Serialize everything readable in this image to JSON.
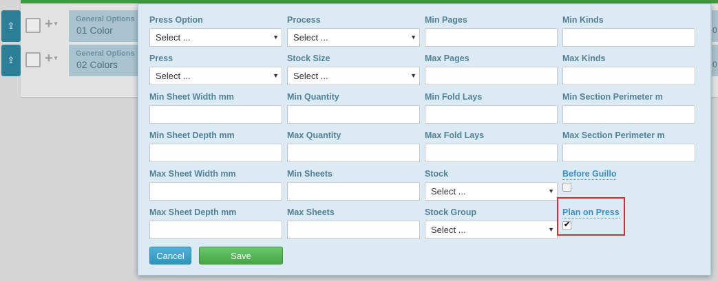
{
  "background": {
    "rows": [
      {
        "option_small": "General Options",
        "option_big": "01 Color",
        "right_char": "0"
      },
      {
        "option_small": "General Options",
        "option_big": "02 Colors",
        "right_char": "0"
      }
    ],
    "side_icon": "share-icon",
    "plus_symbol": "+",
    "caret": "▾"
  },
  "modal": {
    "columns": [
      [
        {
          "label": "Press Option",
          "type": "select",
          "value": "Select ..."
        },
        {
          "label": "Press",
          "type": "select",
          "value": "Select ..."
        },
        {
          "label": "Min Sheet Width mm",
          "type": "input",
          "value": ""
        },
        {
          "label": "Min Sheet Depth mm",
          "type": "input",
          "value": ""
        },
        {
          "label": "Max Sheet Width mm",
          "type": "input",
          "value": ""
        },
        {
          "label": "Max Sheet Depth mm",
          "type": "input",
          "value": ""
        }
      ],
      [
        {
          "label": "Process",
          "type": "select",
          "value": "Select ..."
        },
        {
          "label": "Stock Size",
          "type": "select",
          "value": "Select ..."
        },
        {
          "label": "Min Quantity",
          "type": "input",
          "value": ""
        },
        {
          "label": "Max Quantity",
          "type": "input",
          "value": ""
        },
        {
          "label": "Min Sheets",
          "type": "input",
          "value": ""
        },
        {
          "label": "Max Sheets",
          "type": "input",
          "value": ""
        }
      ],
      [
        {
          "label": "Min Pages",
          "type": "input",
          "value": ""
        },
        {
          "label": "Max Pages",
          "type": "input",
          "value": ""
        },
        {
          "label": "Min Fold Lays",
          "type": "input",
          "value": ""
        },
        {
          "label": "Max Fold Lays",
          "type": "input",
          "value": ""
        },
        {
          "label": "Stock",
          "type": "select",
          "value": "Select ..."
        },
        {
          "label": "Stock Group",
          "type": "select",
          "value": "Select ..."
        }
      ],
      [
        {
          "label": "Min Kinds",
          "type": "input",
          "value": ""
        },
        {
          "label": "Max Kinds",
          "type": "input",
          "value": ""
        },
        {
          "label": "Min Section Perimeter m",
          "type": "input",
          "value": ""
        },
        {
          "label": "Max Section Perimeter m",
          "type": "input",
          "value": ""
        },
        {
          "label": "Before Guillo",
          "type": "checkbox",
          "checked": false
        },
        {
          "label": "Plan on Press",
          "type": "checkbox",
          "checked": true
        }
      ]
    ],
    "cancel_label": "Cancel",
    "save_label": "Save",
    "select_arrow": "▼",
    "check_mark": "✔"
  },
  "colors": {
    "modal_bg": "#dbeaf3",
    "label": "#52819a",
    "link_label": "#3d8ec7",
    "cancel": "#3aa2cb",
    "save": "#55b655",
    "highlight": "#d32f2f"
  }
}
